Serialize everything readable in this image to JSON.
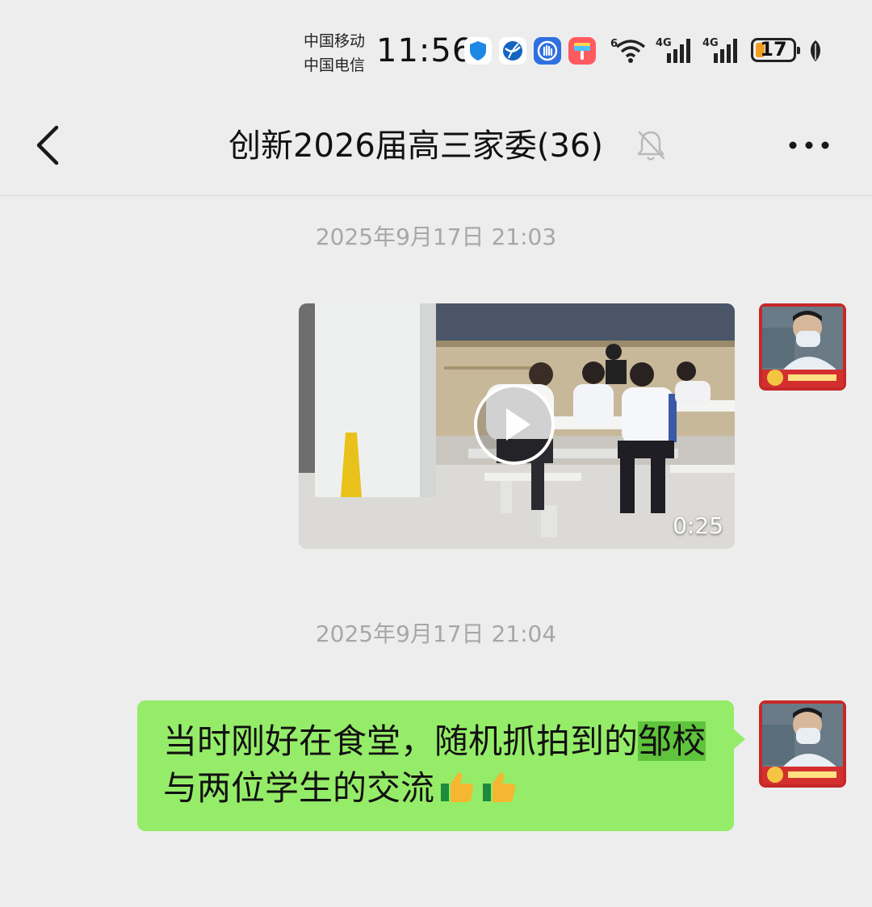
{
  "status_bar": {
    "carrier_1": "中国移动",
    "carrier_2": "中国电信",
    "time": "11:56",
    "wifi_label": "6",
    "sim1_label": "4G",
    "sim2_label": "4G",
    "battery_level": "17",
    "icons": [
      "shield-app-icon",
      "browser-app-icon",
      "hand-app-icon",
      "paint-app-icon",
      "wifi-icon",
      "signal-icon",
      "signal-icon",
      "battery-icon",
      "leaf-icon"
    ]
  },
  "header": {
    "title": "创新2026届高三家委(36)",
    "icons": [
      "back-arrow-icon",
      "mute-bell-icon",
      "more-icon"
    ]
  },
  "messages": [
    {
      "type": "timestamp",
      "text": "2025年9月17日 21:03"
    },
    {
      "type": "video",
      "sender": "self",
      "duration": "0:25"
    },
    {
      "type": "timestamp",
      "text": "2025年9月17日 21:04"
    },
    {
      "type": "text",
      "sender": "self",
      "text_before": "当时刚好在食堂，随机抓拍到的",
      "highlight": "邹校",
      "text_after": "与两位学生的交流",
      "emoji": [
        "👍",
        "👍"
      ]
    }
  ],
  "colors": {
    "background": "#ededed",
    "bubble": "#95ec69",
    "highlight": "#5fc43c",
    "timestamp": "#a7a7a7"
  }
}
